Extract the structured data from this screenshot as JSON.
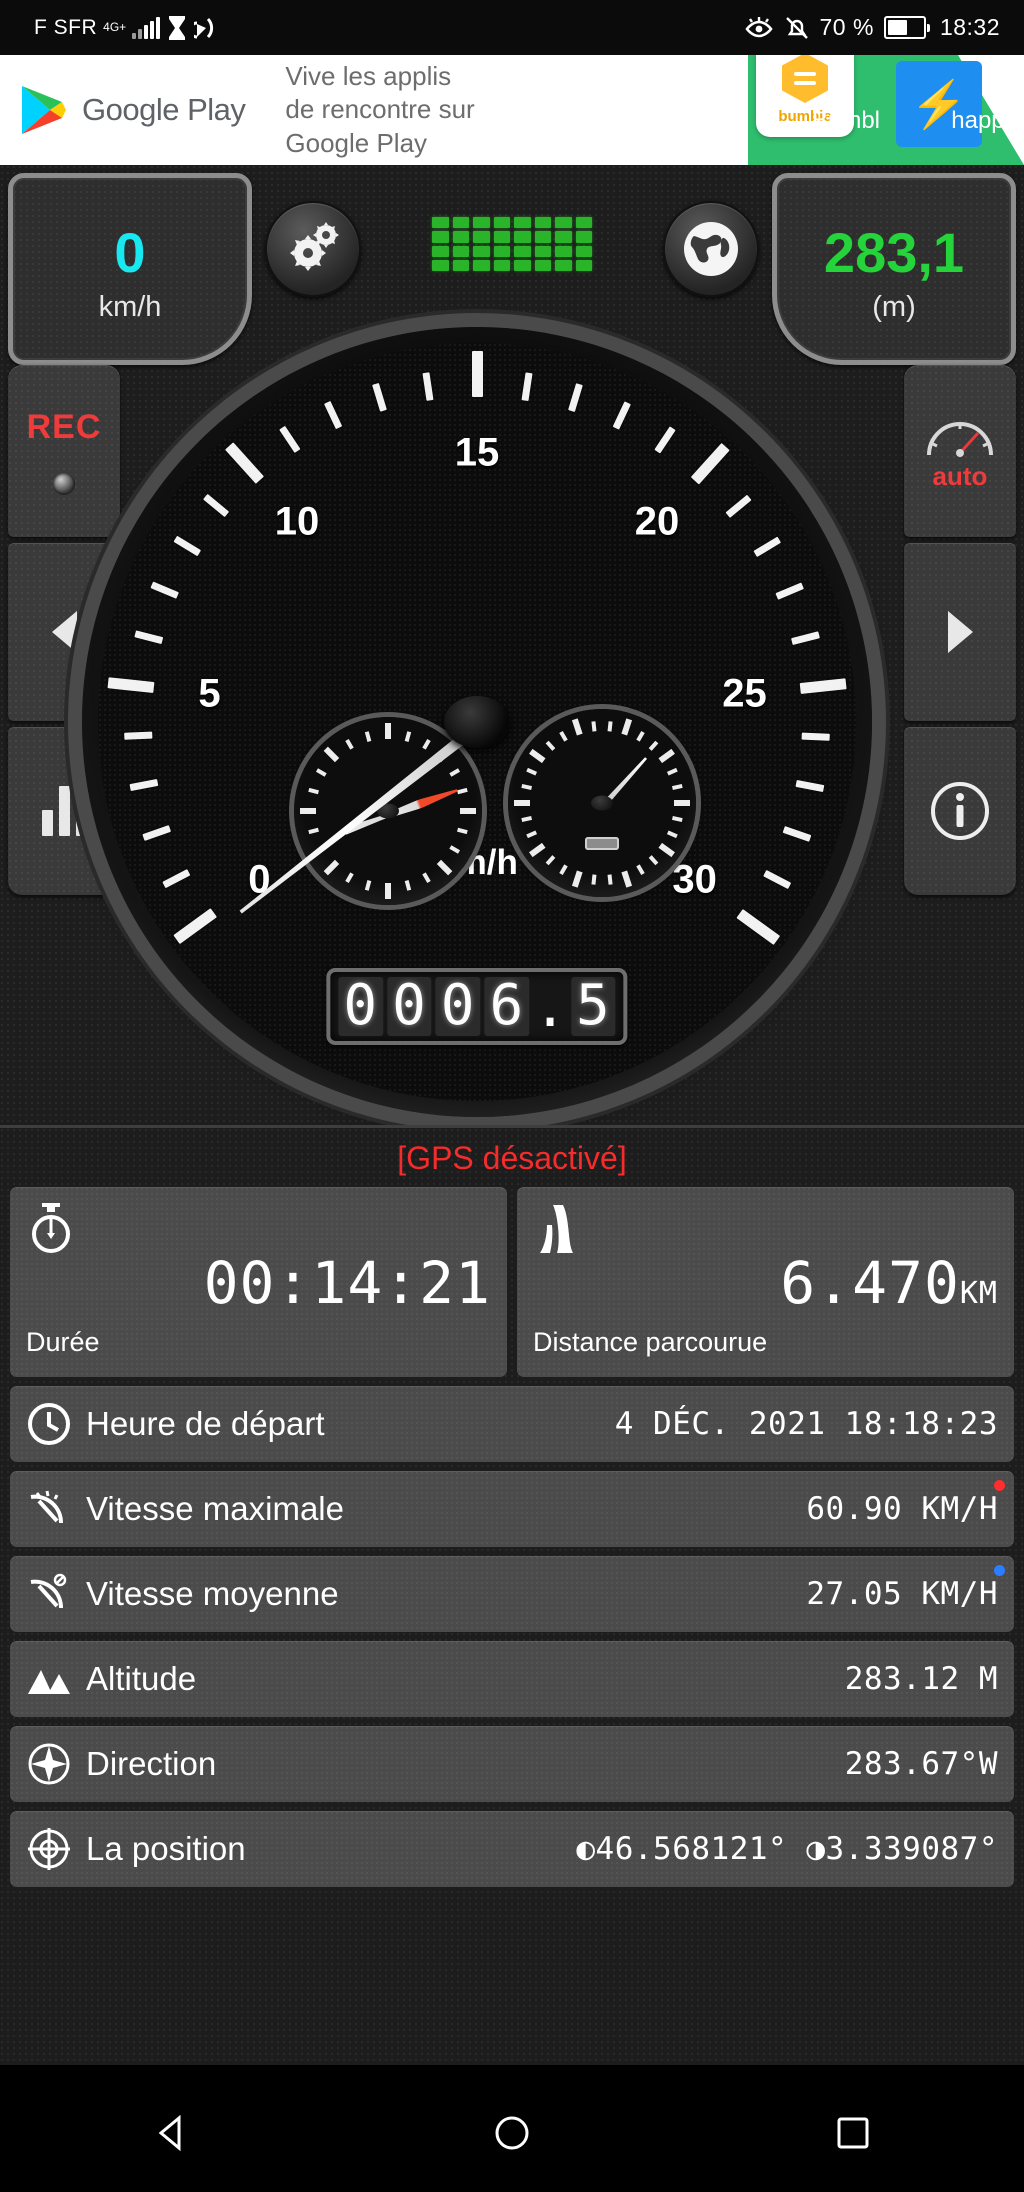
{
  "statusbar": {
    "carrier": "F SFR",
    "network": "4G+",
    "battery_pct": "70 %",
    "clock": "18:32",
    "icons": [
      "hourglass-icon",
      "cast-icon",
      "eye-icon",
      "bell-off-icon",
      "battery-icon"
    ]
  },
  "ad": {
    "brand": "Google Play",
    "copy": "Vive les applis\nde rencontre sur\nGoogle Play",
    "tiles": [
      {
        "name": "bumble",
        "caption": "bumble",
        "label": "Bumbl"
      },
      {
        "name": "happn",
        "caption": "happn",
        "label": "happn"
      }
    ]
  },
  "gauge": {
    "speed_value": "0",
    "speed_unit": "km/h",
    "altitude_value": "283,1",
    "altitude_unit": "(m)",
    "rec_label": "REC",
    "auto_label": "auto",
    "dial_unit": "km/h",
    "dial_labels": [
      "0",
      "5",
      "10",
      "15",
      "20",
      "25",
      "30"
    ],
    "dial_max": 30,
    "odometer": "0006.5",
    "odometer_digits": [
      "0",
      "0",
      "0",
      "6",
      ".",
      "5"
    ],
    "buttons": [
      "settings-gear-button",
      "globe-map-button",
      "rec-button",
      "prev-arrow-button",
      "stats-chart-button",
      "auto-button",
      "next-arrow-button",
      "info-button"
    ],
    "led_columns": 8,
    "led_rows": 4,
    "led_color": "#2ab42a"
  },
  "data": {
    "gps_status": "[GPS désactivé]",
    "gps_status_color": "#f42c2c",
    "cards": [
      {
        "icon": "stopwatch-icon",
        "value": "00:14:21",
        "unit": "",
        "caption": "Durée"
      },
      {
        "icon": "road-icon",
        "value": "6.470",
        "unit": "KM",
        "caption": "Distance parcourue"
      }
    ],
    "rows": [
      {
        "icon": "clock-icon",
        "label": "Heure de départ",
        "value": "4 DÉC. 2021 18:18:23",
        "badge": ""
      },
      {
        "icon": "speed-max-icon",
        "label": "Vitesse maximale",
        "value": "60.90 KM/H",
        "badge": "#ff2d2d"
      },
      {
        "icon": "speed-avg-icon",
        "label": "Vitesse moyenne",
        "value": "27.05 KM/H",
        "badge": "#2d7dff"
      },
      {
        "icon": "mountain-icon",
        "label": "Altitude",
        "value": "283.12 M",
        "badge": ""
      },
      {
        "icon": "compass-icon",
        "label": "Direction",
        "value": "283.67°W",
        "badge": ""
      },
      {
        "icon": "crosshair-icon",
        "label": "La position",
        "value": "◐46.568121° ◑3.339087°",
        "badge": ""
      }
    ]
  },
  "navbar": {
    "items": [
      "back-button",
      "home-button",
      "recents-button"
    ]
  }
}
